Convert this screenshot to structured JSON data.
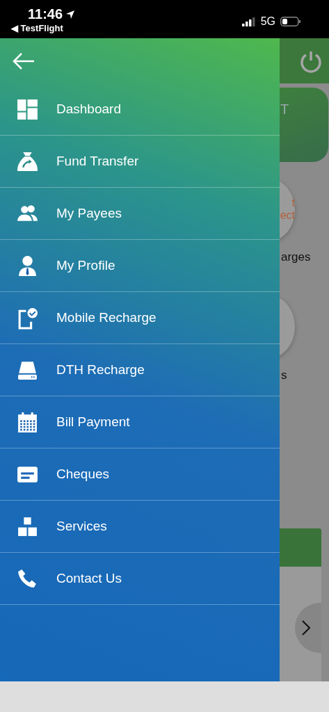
{
  "status_bar": {
    "time": "11:46",
    "back_app": "◀ TestFlight",
    "network": "5G"
  },
  "drawer": {
    "menu_items": [
      {
        "label": "Dashboard"
      },
      {
        "label": "Fund Transfer"
      },
      {
        "label": "My Payees"
      },
      {
        "label": "My Profile"
      },
      {
        "label": "Mobile Recharge"
      },
      {
        "label": "DTH Recharge"
      },
      {
        "label": "Bill Payment"
      },
      {
        "label": "Cheques"
      },
      {
        "label": "Services"
      },
      {
        "label": "Contact Us"
      }
    ]
  },
  "background_screen": {
    "card_text": "T",
    "tile_1_text": [
      "t",
      "ect"
    ],
    "tile_1_label": "arges",
    "tile_2_label": "s"
  }
}
